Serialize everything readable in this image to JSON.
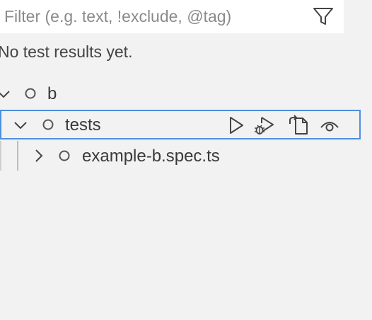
{
  "filter": {
    "placeholder": "Filter (e.g. text, !exclude, @tag)",
    "value": ""
  },
  "message": "No test results yet.",
  "tree": {
    "root": {
      "label": "b",
      "expanded": true,
      "status": "not-run"
    },
    "folder": {
      "label": "tests",
      "expanded": true,
      "status": "not-run",
      "selected": true,
      "actions": [
        "run-test-icon",
        "debug-test-icon",
        "go-to-test-icon",
        "watch-icon"
      ]
    },
    "file": {
      "label": "example-b.spec.ts",
      "expanded": false,
      "status": "not-run"
    }
  },
  "colors": {
    "background": "#f2f2f2",
    "input_background": "#ffffff",
    "focus_border": "#4d8fde",
    "text": "#3b3b3b"
  }
}
